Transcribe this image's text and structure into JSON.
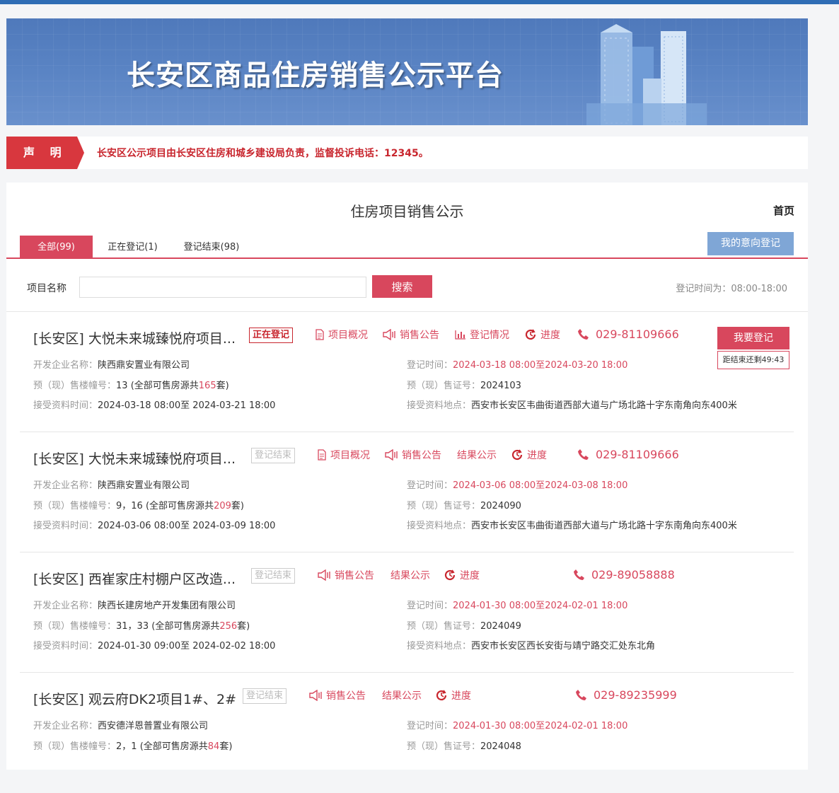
{
  "banner": {
    "title": "长安区商品住房销售公示平台"
  },
  "notice": {
    "tag": "声 明",
    "text": "长安区公示项目由长安区住房和城乡建设局负责，监督投诉电话：12345。"
  },
  "main": {
    "title": "住房项目销售公示",
    "home_link": "首页",
    "tabs": [
      {
        "label": "全部(99)"
      },
      {
        "label": "正在登记(1)"
      },
      {
        "label": "登记结束(98)"
      }
    ],
    "my_registration": "我的意向登记",
    "search": {
      "label": "项目名称",
      "value": "",
      "placeholder": "",
      "button": "搜索"
    },
    "reg_hours": "登记时间为：08:00-18:00"
  },
  "labels": {
    "developer": "开发企业名称：",
    "buildings": "预（现）售楼幢号：",
    "accept_time": "接受资料时间：",
    "reg_time": "登记时间：",
    "permit": "预（现）售证号：",
    "location": "接受资料地点：",
    "total_prefix": "(全部可售房源共",
    "total_suffix": "套)",
    "to": "至",
    "overview": "项目概况",
    "sales_notice": "销售公告",
    "reg_status": "登记情况",
    "result": "结果公示",
    "progress": "进度",
    "register": "我要登记",
    "countdown": "距结束还剩49:43"
  },
  "projects": [
    {
      "title": "[长安区] 大悦未来城臻悦府项目...",
      "status": "正在登记",
      "phone": "029-81109666",
      "developer": "陕西鼎安置业有限公司",
      "buildings": "13",
      "total": "165",
      "accept_time": "2024-03-18 08:00至 2024-03-21 18:00",
      "reg_start": "2024-03-18 08:00",
      "reg_end": "2024-03-20 18:00",
      "permit": "2024103",
      "location": "西安市长安区韦曲街道西部大道与广场北路十字东南角向东400米"
    },
    {
      "title": "[长安区] 大悦未来城臻悦府项目...",
      "status": "登记结束",
      "phone": "029-81109666",
      "developer": "陕西鼎安置业有限公司",
      "buildings": "9，16",
      "total": "209",
      "accept_time": "2024-03-06 08:00至 2024-03-09 18:00",
      "reg_start": "2024-03-06 08:00",
      "reg_end": "2024-03-08 18:00",
      "permit": "2024090",
      "location": "西安市长安区韦曲街道西部大道与广场北路十字东南角向东400米"
    },
    {
      "title": "[长安区] 西崔家庄村棚户区改造...",
      "status": "登记结束",
      "phone": "029-89058888",
      "developer": "陕西长建房地产开发集团有限公司",
      "buildings": "31，33",
      "total": "256",
      "accept_time": "2024-01-30 09:00至 2024-02-02 18:00",
      "reg_start": "2024-01-30 08:00",
      "reg_end": "2024-02-01 18:00",
      "permit": "2024049",
      "location": "西安市长安区西长安街与靖宁路交汇处东北角"
    },
    {
      "title": "[长安区] 观云府DK2项目1#、2#",
      "status": "登记结束",
      "phone": "029-89235999",
      "developer": "西安德洋恩普置业有限公司",
      "buildings": "2，1",
      "total": "84",
      "accept_time": "",
      "reg_start": "2024-01-30 08:00",
      "reg_end": "2024-02-01 18:00",
      "permit": "2024048",
      "location": ""
    }
  ],
  "colors": {
    "accent": "#d8475d",
    "blue": "#2f6db5",
    "notice_red": "#d8373e"
  }
}
